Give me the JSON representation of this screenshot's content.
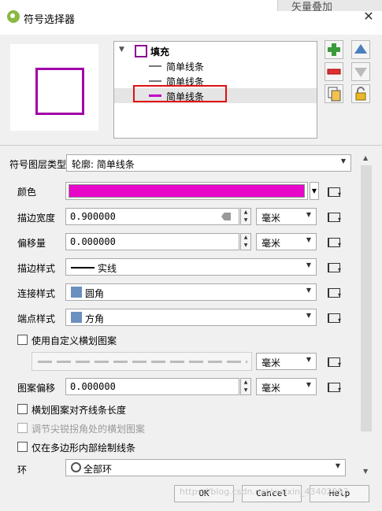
{
  "window": {
    "title": "符号选择器",
    "background_panel_text": "矢量叠加"
  },
  "tree": {
    "items": [
      {
        "label": "填充"
      },
      {
        "label": "简单线条"
      },
      {
        "label": "简单线条"
      },
      {
        "label": "简单线条"
      }
    ]
  },
  "layer_type": {
    "label": "符号图层类型",
    "value": "轮廓: 简单线条"
  },
  "color": {
    "label": "颜色",
    "value": "#e806c9"
  },
  "stroke_width": {
    "label": "描边宽度",
    "value": "0.900000",
    "unit": "毫米"
  },
  "offset": {
    "label": "偏移量",
    "value": "0.000000",
    "unit": "毫米"
  },
  "stroke_style": {
    "label": "描边样式",
    "value": "实线"
  },
  "join_style": {
    "label": "连接样式",
    "value": "圆角"
  },
  "cap_style": {
    "label": "端点样式",
    "value": "方角"
  },
  "custom_dash": {
    "label": "使用自定义横划图案",
    "unit": "毫米"
  },
  "pattern_offset": {
    "label": "图案偏移",
    "value": "0.000000",
    "unit": "毫米"
  },
  "align_dash": {
    "label": "横划图案对齐线条长度"
  },
  "tweak_dash": {
    "label": "调节尖锐拐角处的横划图案"
  },
  "draw_inside": {
    "label": "仅在多边形内部绘制线条"
  },
  "ring": {
    "label": "环",
    "value": "全部环"
  },
  "buttons": {
    "ok": "OK",
    "cancel": "Cancel",
    "help": "Help"
  },
  "watermark": "https://blog.csdn.net/weixin_43402993"
}
